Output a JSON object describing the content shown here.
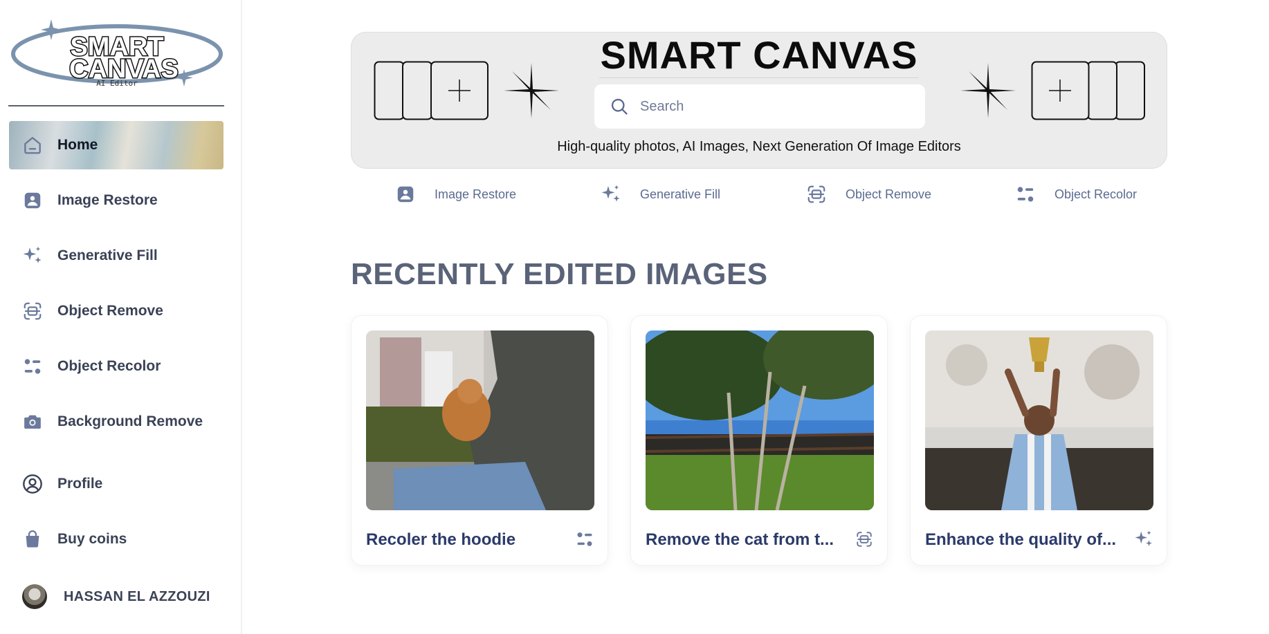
{
  "app": {
    "logo_text": "SMART CANVAS",
    "logo_subtitle": "AI Editor"
  },
  "sidebar": {
    "items": [
      {
        "label": "Home",
        "icon": "home-icon",
        "active": true
      },
      {
        "label": "Image Restore",
        "icon": "image-icon"
      },
      {
        "label": "Generative Fill",
        "icon": "sparkles-icon"
      },
      {
        "label": "Object Remove",
        "icon": "scan-object-icon"
      },
      {
        "label": "Object Recolor",
        "icon": "toggles-icon"
      },
      {
        "label": "Background Remove",
        "icon": "camera-icon"
      },
      {
        "label": "Profile",
        "icon": "user-circle-icon"
      },
      {
        "label": "Buy coins",
        "icon": "shopping-bag-icon"
      }
    ],
    "user": {
      "name": "HASSAN EL AZZOUZI"
    }
  },
  "hero": {
    "title": "SMART CANVAS",
    "search_placeholder": "Search",
    "subtitle": "High-quality photos, AI Images, Next Generation Of Image Editors"
  },
  "quick_links": [
    {
      "label": "Image Restore",
      "icon": "image-icon"
    },
    {
      "label": "Generative Fill",
      "icon": "sparkles-icon"
    },
    {
      "label": "Object Remove",
      "icon": "scan-object-icon"
    },
    {
      "label": "Object Recolor",
      "icon": "toggles-icon"
    }
  ],
  "recent": {
    "title": "RECENTLY EDITED IMAGES",
    "cards": [
      {
        "title": "Recoler the hoodie",
        "icon": "toggles-icon",
        "image": "person with cat on lap"
      },
      {
        "title": "Remove the cat from t...",
        "icon": "scan-object-icon",
        "image": "trees and fence in park"
      },
      {
        "title": "Enhance the quality of...",
        "icon": "sparkles-icon",
        "image": "football player lifting trophy"
      }
    ]
  },
  "colors": {
    "icon": "#6b7a9c",
    "text_dark": "#2b3a6a",
    "hero_bg": "#ececec",
    "section_title": "#5a6378"
  }
}
